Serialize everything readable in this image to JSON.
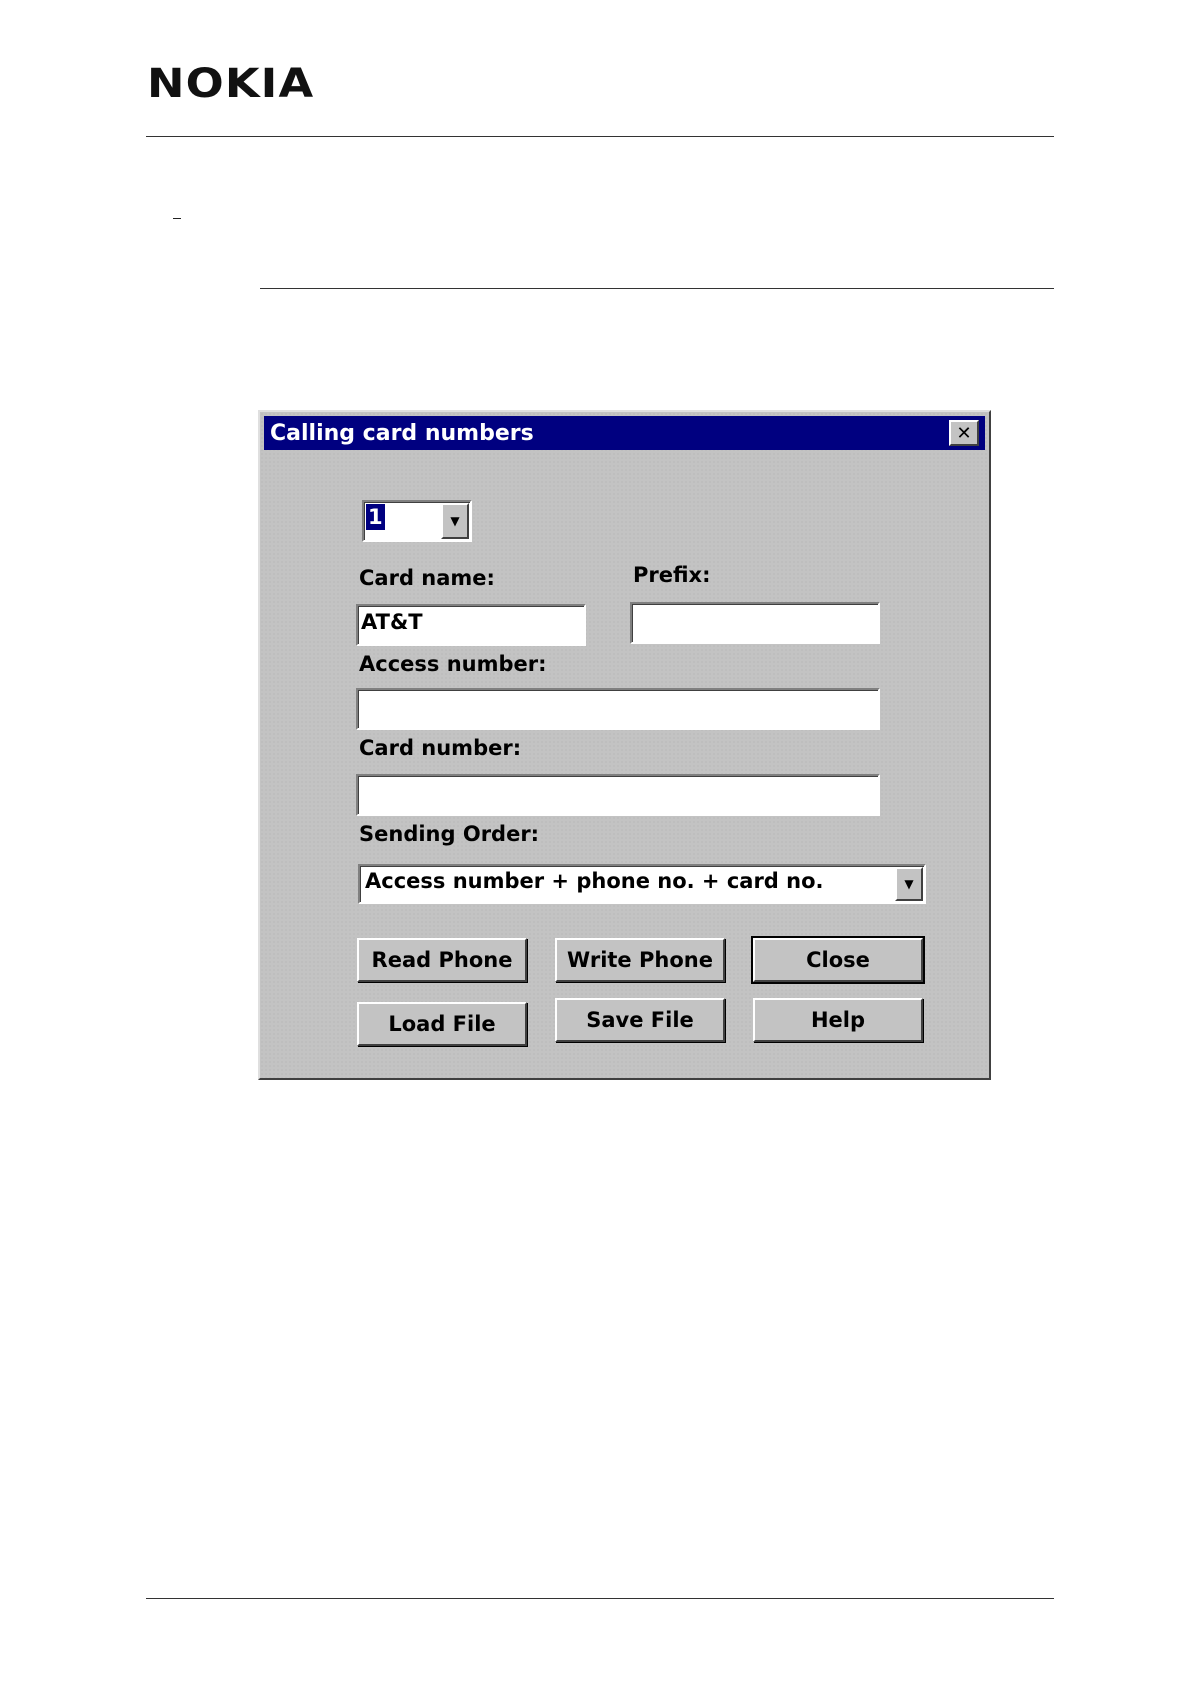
{
  "header": {
    "brand": "NOKIA"
  },
  "dialog": {
    "title": "Calling card numbers",
    "close_symbol": "✕",
    "index_selector": {
      "value": "1"
    },
    "card_name": {
      "label": "Card name:",
      "value": "AT&T"
    },
    "prefix": {
      "label": "Prefix:",
      "value": ""
    },
    "access_number": {
      "label": "Access number:",
      "value": ""
    },
    "card_number": {
      "label": "Card number:",
      "value": ""
    },
    "sending_order": {
      "label": "Sending Order:",
      "value": "Access number + phone no. + card no."
    },
    "buttons": {
      "read_phone": "Read Phone",
      "write_phone": "Write Phone",
      "close": "Close",
      "load_file": "Load File",
      "save_file": "Save File",
      "help": "Help"
    }
  },
  "icons": {
    "dropdown": "chevron-down-icon",
    "close": "close-icon"
  }
}
